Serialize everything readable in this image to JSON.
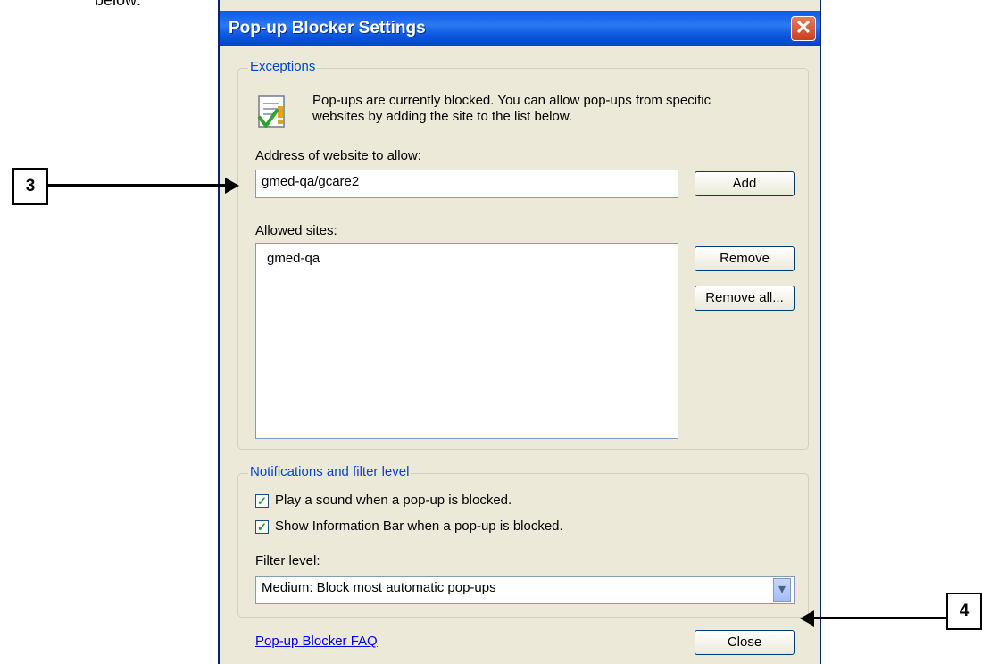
{
  "page": {
    "cut_text": "below:"
  },
  "dialog": {
    "title": "Pop-up Blocker Settings",
    "close_glyph": "✕",
    "exceptions": {
      "legend": "Exceptions",
      "info_line1": "Pop-ups are currently blocked.  You can allow pop-ups from specific",
      "info_line2": "websites by adding the site to the list below.",
      "address_label": "Address of website to allow:",
      "address_value": "gmed-qa/gcare2",
      "add_label": "Add",
      "allowed_label": "Allowed sites:",
      "allowed_sites": [
        "gmed-qa"
      ],
      "remove_label": "Remove",
      "remove_all_label": "Remove all..."
    },
    "notifications": {
      "legend": "Notifications and filter level",
      "play_sound_label": "Play a sound when a pop-up is blocked.",
      "play_sound_checked": true,
      "show_infobar_label": "Show Information Bar when a pop-up is blocked.",
      "show_infobar_checked": true,
      "filter_label": "Filter level:",
      "filter_value": "Medium: Block most automatic pop-ups"
    },
    "faq_link": "Pop-up Blocker FAQ",
    "close_button": "Close"
  },
  "callouts": [
    {
      "label": "3"
    },
    {
      "label": "4"
    }
  ],
  "icons": {
    "check_glyph": "✓",
    "dropdown_glyph": "▾",
    "info_icon": "checklist-warning-icon"
  }
}
